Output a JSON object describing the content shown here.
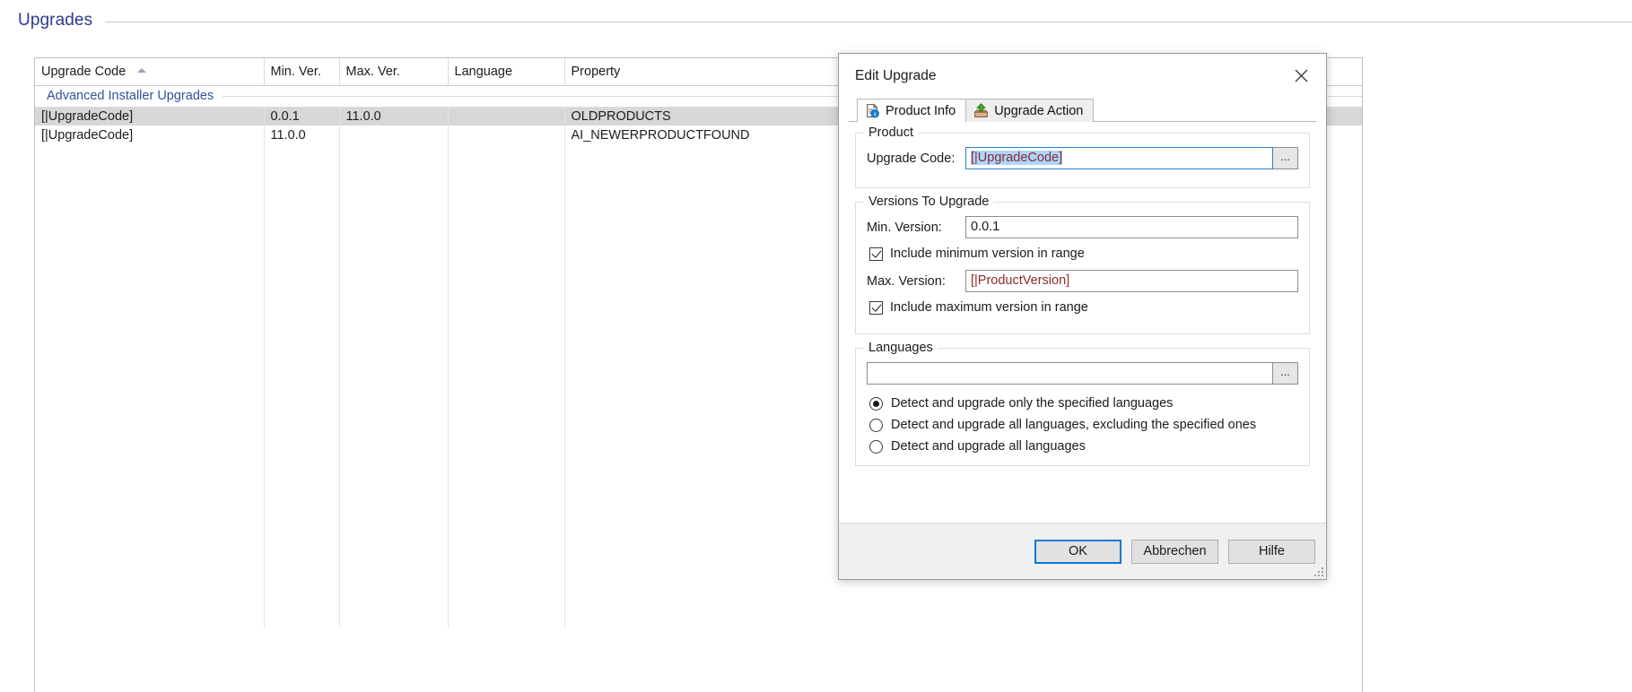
{
  "page": {
    "title": "Upgrades"
  },
  "grid": {
    "columns": [
      {
        "label": "Upgrade Code",
        "sorted": true,
        "sort_direction": "asc"
      },
      {
        "label": "Min. Ver.",
        "sorted": false
      },
      {
        "label": "Max. Ver.",
        "sorted": false
      },
      {
        "label": "Language",
        "sorted": false
      },
      {
        "label": "Property",
        "sorted": false
      }
    ],
    "group_label": "Advanced Installer Upgrades",
    "rows": [
      {
        "upgrade_code": "[|UpgradeCode]",
        "min_ver": "0.0.1",
        "max_ver": "11.0.0",
        "language": "",
        "property": "OLDPRODUCTS",
        "selected": true
      },
      {
        "upgrade_code": "[|UpgradeCode]",
        "min_ver": "11.0.0",
        "max_ver": "",
        "language": "",
        "property": "AI_NEWERPRODUCTFOUND",
        "selected": false
      }
    ]
  },
  "dialog": {
    "title": "Edit Upgrade",
    "close_icon": "close-icon",
    "tabs": [
      {
        "label": "Product Info",
        "icon": "document-info-icon",
        "active": true
      },
      {
        "label": "Upgrade Action",
        "icon": "package-upgrade-icon",
        "active": false
      }
    ],
    "product_group": {
      "title": "Product",
      "upgrade_code_label": "Upgrade Code:",
      "upgrade_code_value": "[|UpgradeCode]",
      "browse_label": "...",
      "focused": true,
      "selected": true
    },
    "versions_group": {
      "title": "Versions To Upgrade",
      "min_version_label": "Min. Version:",
      "min_version_value": "0.0.1",
      "include_min_label": "Include minimum version in range",
      "include_min_checked": true,
      "max_version_label": "Max. Version:",
      "max_version_value": "[|ProductVersion]",
      "include_max_label": "Include maximum version in range",
      "include_max_checked": true
    },
    "languages_group": {
      "title": "Languages",
      "languages_value": "",
      "browse_label": "...",
      "options": [
        {
          "label": "Detect and upgrade only the specified languages",
          "selected": true
        },
        {
          "label": "Detect and upgrade all languages, excluding the specified ones",
          "selected": false
        },
        {
          "label": "Detect and upgrade all languages",
          "selected": false
        }
      ]
    },
    "buttons": [
      {
        "label": "OK",
        "default": true
      },
      {
        "label": "Abbrechen",
        "default": false
      },
      {
        "label": "Hilfe",
        "default": false
      }
    ]
  },
  "colors": {
    "accent": "#2b3a8f",
    "group_link": "#31529b",
    "focus_border": "#0078d7",
    "selection": "#add6ff",
    "formatted_text": "#8c2b2b",
    "row_selected": "#d7d7d7"
  }
}
